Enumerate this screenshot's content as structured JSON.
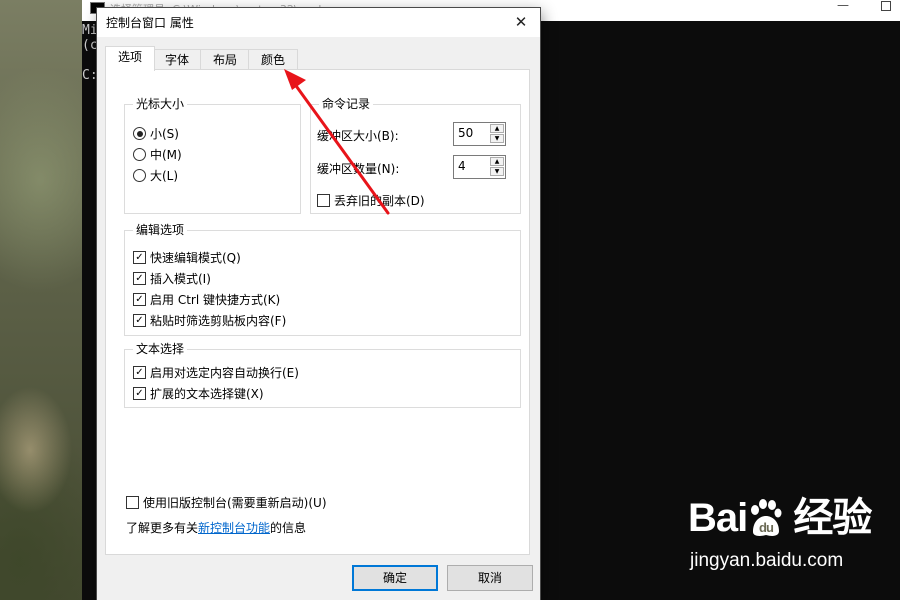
{
  "cmd_window": {
    "title": "选择管理员: C:\\Windows\\system32\\cmd.exe",
    "lines": [
      "Mi",
      "(c",
      "",
      "C:"
    ],
    "controls": {
      "minimize": "—"
    }
  },
  "dialog": {
    "title": "控制台窗口 属性",
    "close_label": "✕",
    "tabs": [
      {
        "label": "选项",
        "active": true
      },
      {
        "label": "字体",
        "active": false
      },
      {
        "label": "布局",
        "active": false
      },
      {
        "label": "颜色",
        "active": false
      }
    ],
    "cursor_size": {
      "title": "光标大小",
      "options": [
        {
          "label": "小(S)",
          "checked": true
        },
        {
          "label": "中(M)",
          "checked": false
        },
        {
          "label": "大(L)",
          "checked": false
        }
      ]
    },
    "command_history": {
      "title": "命令记录",
      "buffer_size_label": "缓冲区大小(B):",
      "buffer_size_value": "50",
      "buffer_count_label": "缓冲区数量(N):",
      "buffer_count_value": "4",
      "discard_label": "丢弃旧的副本(D)",
      "discard_checked": false
    },
    "edit_options": {
      "title": "编辑选项",
      "items": [
        {
          "label": "快速编辑模式(Q)",
          "checked": true
        },
        {
          "label": "插入模式(I)",
          "checked": true
        },
        {
          "label": "启用 Ctrl 键快捷方式(K)",
          "checked": true
        },
        {
          "label": "粘贴时筛选剪贴板内容(F)",
          "checked": true
        }
      ]
    },
    "text_selection": {
      "title": "文本选择",
      "items": [
        {
          "label": "启用对选定内容自动换行(E)",
          "checked": true
        },
        {
          "label": "扩展的文本选择键(X)",
          "checked": true
        }
      ]
    },
    "legacy_console": {
      "label": "使用旧版控制台(需要重新启动)(U)",
      "checked": false
    },
    "learn_more": {
      "prefix": "了解更多有关",
      "link": "新控制台功能",
      "suffix": "的信息"
    },
    "buttons": {
      "ok": "确定",
      "cancel": "取消"
    }
  },
  "annotation": {
    "arrow_color": "#e8141a"
  },
  "watermark": {
    "logo": "Bai du 经验",
    "url": "jingyan.baidu.com"
  },
  "colors": {
    "accent": "#0078d7",
    "link": "#0066cc",
    "console_bg": "#0c0c0c"
  }
}
